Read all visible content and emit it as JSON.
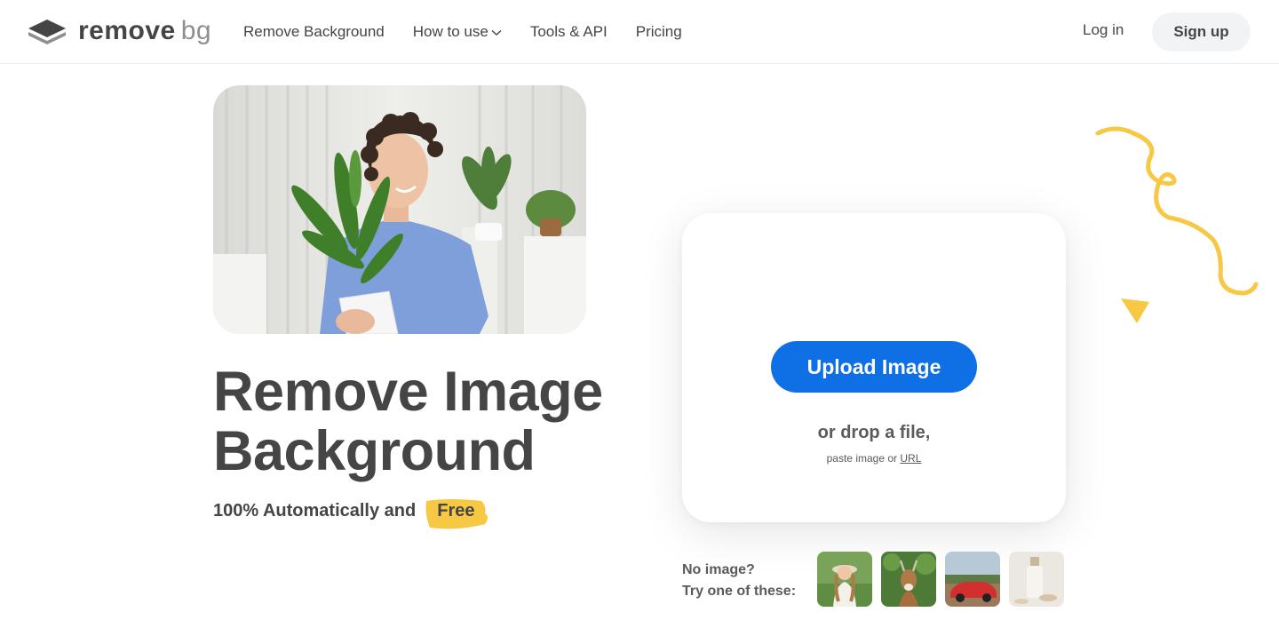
{
  "header": {
    "logo": {
      "word1": "remove",
      "word2": "bg"
    },
    "nav": [
      {
        "label": "Remove Background"
      },
      {
        "label": "How to use"
      },
      {
        "label": "Tools & API"
      },
      {
        "label": "Pricing"
      }
    ],
    "login_label": "Log in",
    "signup_label": "Sign up"
  },
  "hero": {
    "title_line1": "Remove Image",
    "title_line2": "Background",
    "subtitle_prefix": "100% Automatically and",
    "subtitle_highlight": "Free"
  },
  "upload": {
    "button_label": "Upload Image",
    "drop_text": "or drop a file,",
    "paste_prefix": "paste image or",
    "paste_link": "URL"
  },
  "samples": {
    "label_line1": "No image?",
    "label_line2": "Try one of these:",
    "items": [
      "sample-woman",
      "sample-deer",
      "sample-car",
      "sample-cosmetics"
    ]
  },
  "colors": {
    "accent": "#0f70e6",
    "highlight": "#f6c843",
    "text": "#454545"
  }
}
